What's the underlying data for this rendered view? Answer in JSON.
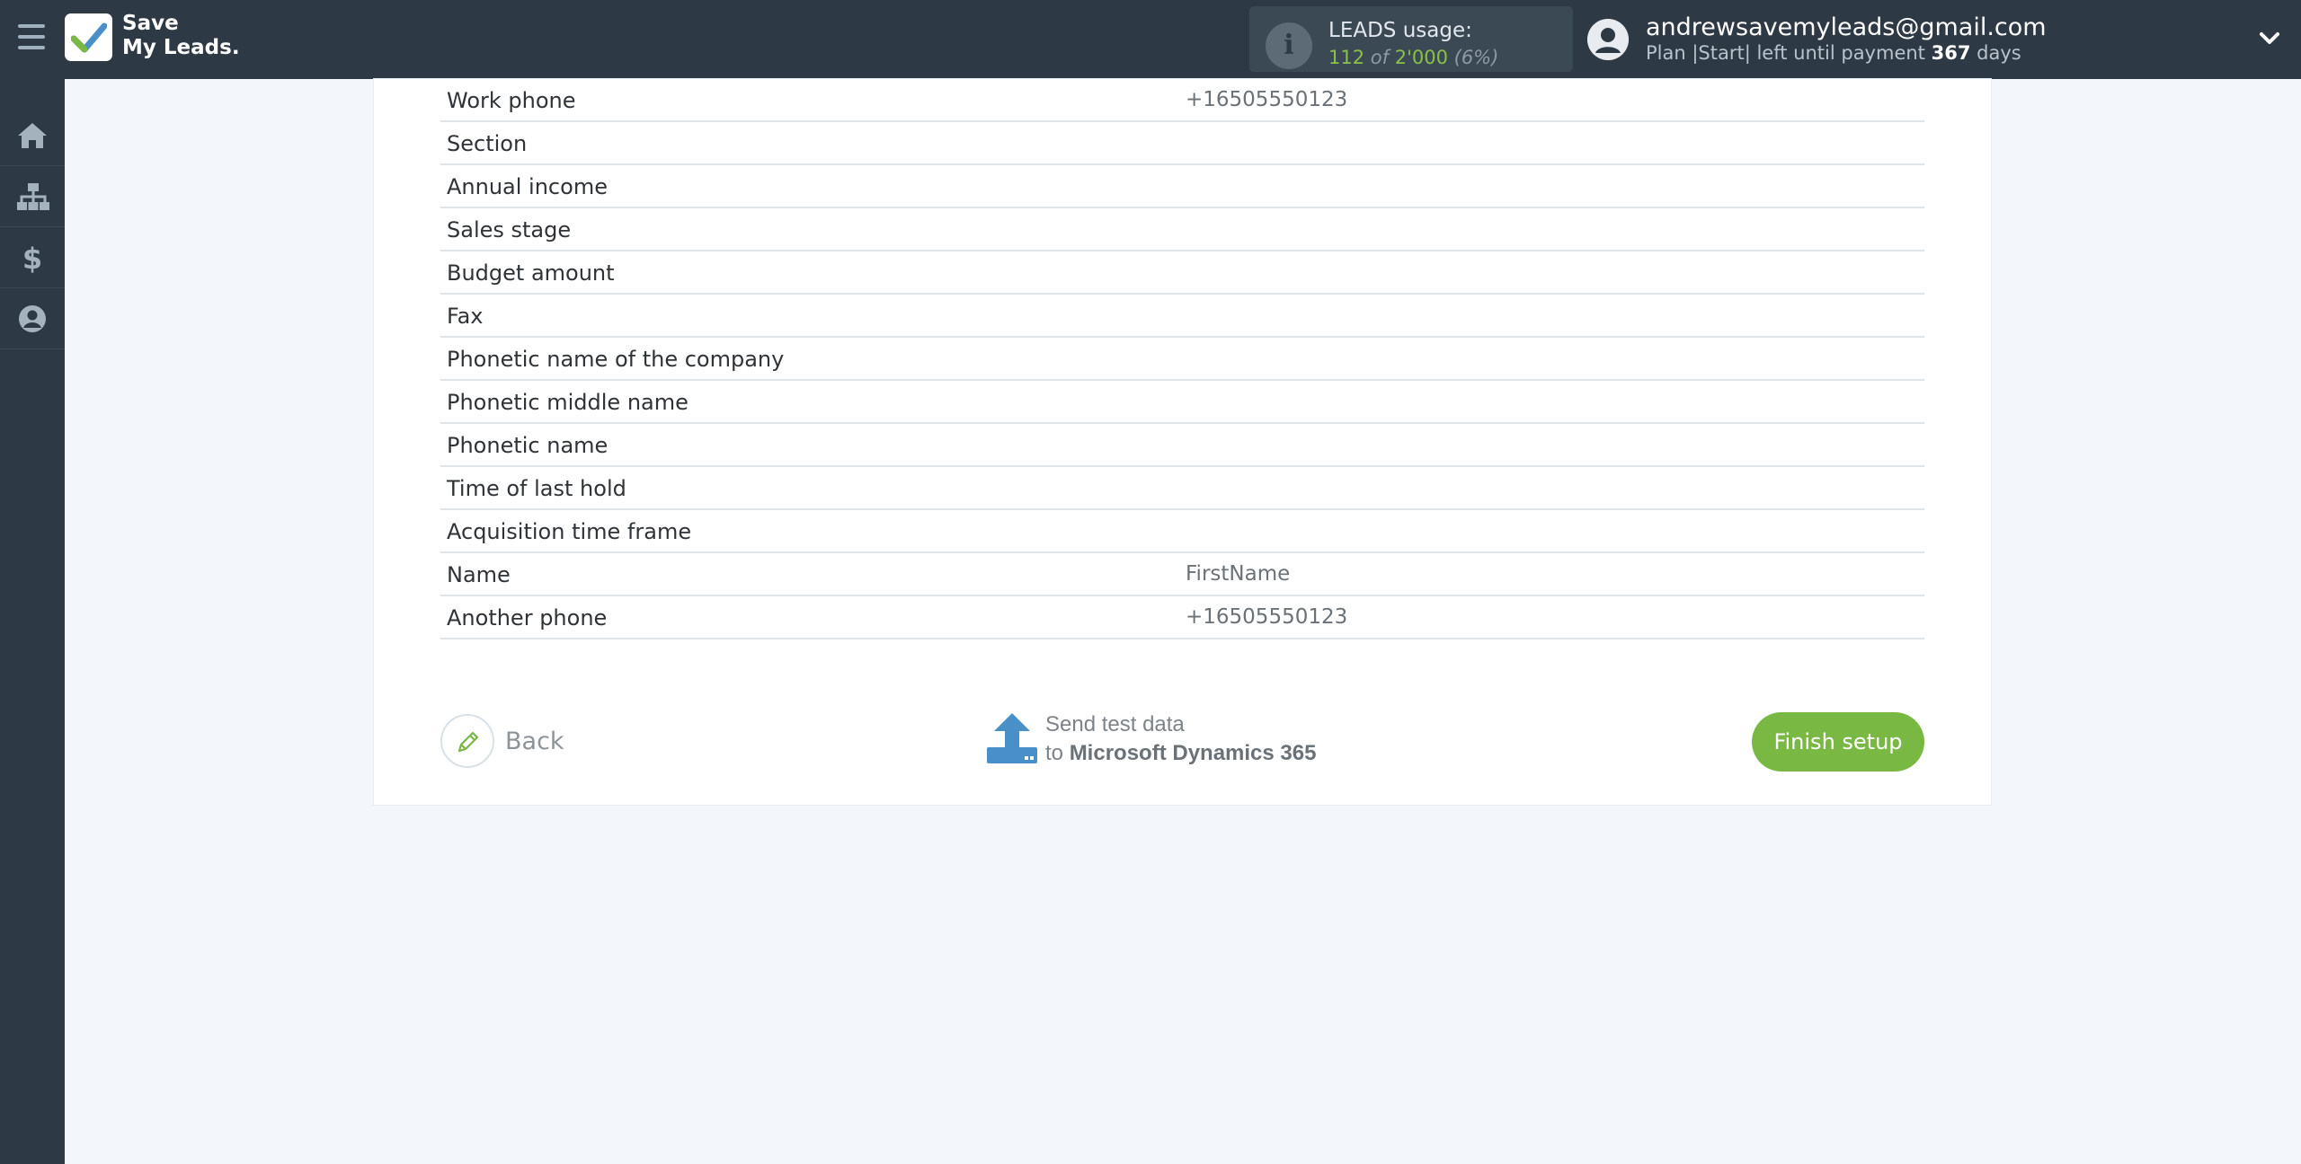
{
  "header": {
    "logo_line1": "Save",
    "logo_line2": "My Leads.",
    "usage": {
      "title": "LEADS usage:",
      "used": "112",
      "of": "of",
      "total": "2'000",
      "percent": "(6%)"
    },
    "user": {
      "email": "andrewsavemyleads@gmail.com",
      "plan_prefix": "Plan |Start| left until payment",
      "days": "367",
      "days_suffix": "days"
    }
  },
  "sidebar": {
    "items": [
      {
        "name": "home-icon"
      },
      {
        "name": "sitemap-icon"
      },
      {
        "name": "dollar-icon"
      },
      {
        "name": "user-circle-icon"
      }
    ]
  },
  "fields": [
    {
      "name": "Work phone",
      "value": "+16505550123"
    },
    {
      "name": "Section",
      "value": ""
    },
    {
      "name": "Annual income",
      "value": ""
    },
    {
      "name": "Sales stage",
      "value": ""
    },
    {
      "name": "Budget amount",
      "value": ""
    },
    {
      "name": "Fax",
      "value": ""
    },
    {
      "name": "Phonetic name of the company",
      "value": ""
    },
    {
      "name": "Phonetic middle name",
      "value": ""
    },
    {
      "name": "Phonetic name",
      "value": ""
    },
    {
      "name": "Time of last hold",
      "value": ""
    },
    {
      "name": "Acquisition time frame",
      "value": ""
    },
    {
      "name": "Name",
      "value": "FirstName"
    },
    {
      "name": "Another phone",
      "value": "+16505550123"
    }
  ],
  "actions": {
    "back_label": "Back",
    "send_line1": "Send test data",
    "send_to": "to",
    "send_target": "Microsoft Dynamics 365",
    "finish_label": "Finish setup"
  },
  "colors": {
    "accent_green": "#78b843",
    "header_bg": "#2d3a46",
    "send_icon_blue": "#4a90c8"
  }
}
